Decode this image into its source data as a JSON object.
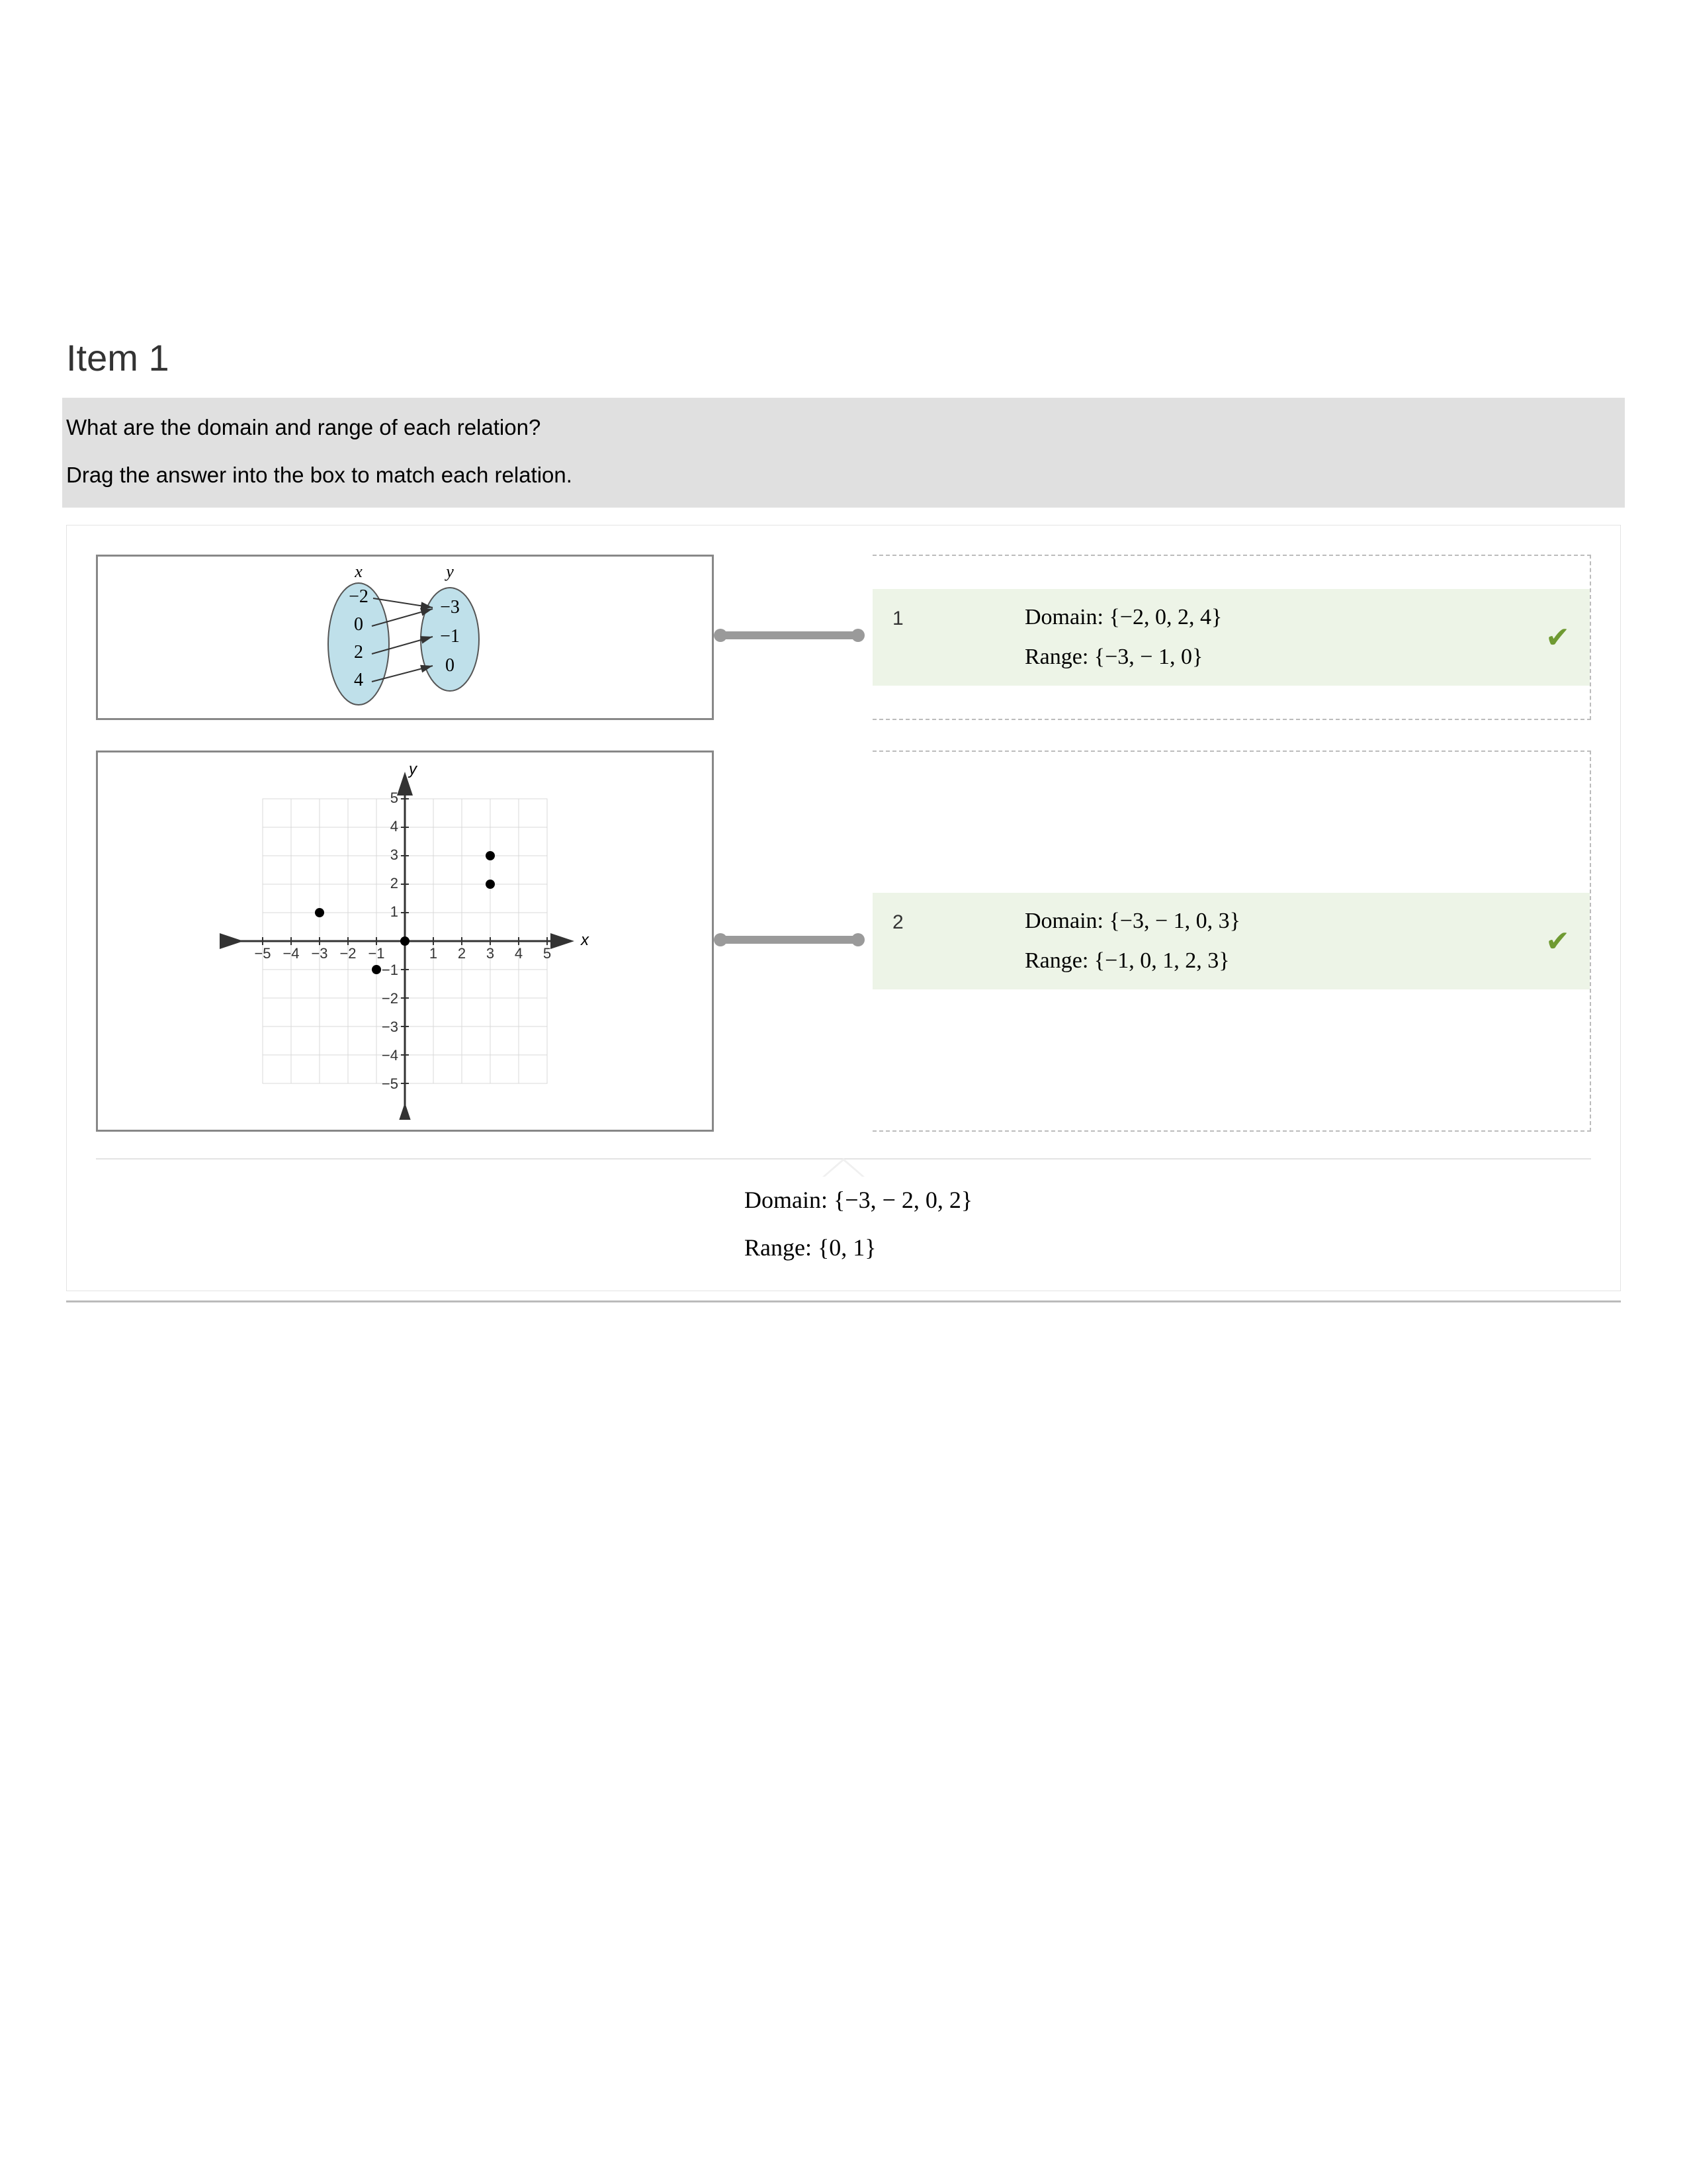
{
  "title": "Item 1",
  "question": "What are the domain and range of each relation?",
  "instruction": "Drag the answer into the box to match each relation.",
  "mapping": {
    "xLabel": "x",
    "yLabel": "y",
    "xValues": [
      "−2",
      "0",
      "2",
      "4"
    ],
    "yValues": [
      "−3",
      "−1",
      "0"
    ]
  },
  "graph": {
    "xLabel": "x",
    "yLabel": "y",
    "xTicks": [
      "−5",
      "−4",
      "−3",
      "−2",
      "−1",
      "1",
      "2",
      "3",
      "4",
      "5"
    ],
    "yTicksPos": [
      "1",
      "2",
      "3",
      "4",
      "5"
    ],
    "yTicksNeg": [
      "−1",
      "−2",
      "−3",
      "−4",
      "−5"
    ],
    "points": [
      [
        -3,
        1
      ],
      [
        -1,
        -1
      ],
      [
        0,
        0
      ],
      [
        3,
        3
      ],
      [
        3,
        2
      ]
    ]
  },
  "drops": [
    {
      "num": "1",
      "domain": "Domain: {−2, 0, 2, 4}",
      "range": "Range: {−3,  − 1, 0}"
    },
    {
      "num": "2",
      "domain": "Domain: {−3,  − 1, 0, 3}",
      "range": "Range: {−1, 0, 1, 2, 3}"
    }
  ],
  "bank": {
    "domain": "Domain: {−3,  − 2, 0, 2}",
    "range": "Range: {0, 1}"
  },
  "checkGlyph": "✔"
}
